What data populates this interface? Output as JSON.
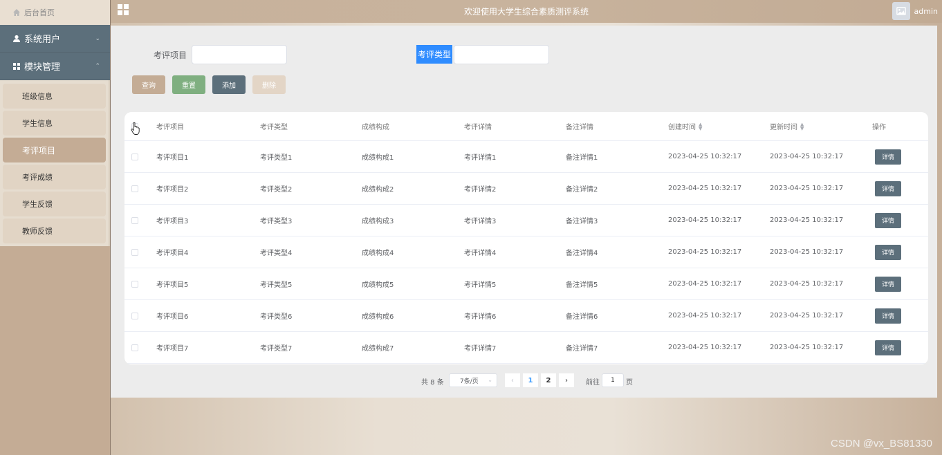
{
  "header": {
    "title": "欢迎使用大学生综合素质测评系统",
    "user": "admin"
  },
  "sidebar": {
    "home": "后台首页",
    "groups": [
      {
        "label": "系统用户",
        "arrow": "⌄"
      },
      {
        "label": "模块管理",
        "arrow": "⌃"
      }
    ],
    "items": [
      {
        "label": "班级信息"
      },
      {
        "label": "学生信息"
      },
      {
        "label": "考评项目"
      },
      {
        "label": "考评成绩"
      },
      {
        "label": "学生反馈"
      },
      {
        "label": "教师反馈"
      }
    ],
    "active_item": "考评项目"
  },
  "search": {
    "field1_label": "考评项目",
    "field1_value": "",
    "field2_label": "考评类型",
    "field2_value": ""
  },
  "buttons": {
    "query": "查询",
    "reset": "重置",
    "add": "添加",
    "delete": "删除"
  },
  "table": {
    "columns": [
      "考评项目",
      "考评类型",
      "成绩构成",
      "考评详情",
      "备注详情",
      "创建时间",
      "更新时间",
      "操作"
    ],
    "sortable_columns": [
      "创建时间",
      "更新时间"
    ],
    "action_label": "详情",
    "rows": [
      [
        "考评项目1",
        "考评类型1",
        "成绩构成1",
        "考评详情1",
        "备注详情1",
        "2023-04-25 10:32:17",
        "2023-04-25 10:32:17"
      ],
      [
        "考评项目2",
        "考评类型2",
        "成绩构成2",
        "考评详情2",
        "备注详情2",
        "2023-04-25 10:32:17",
        "2023-04-25 10:32:17"
      ],
      [
        "考评项目3",
        "考评类型3",
        "成绩构成3",
        "考评详情3",
        "备注详情3",
        "2023-04-25 10:32:17",
        "2023-04-25 10:32:17"
      ],
      [
        "考评项目4",
        "考评类型4",
        "成绩构成4",
        "考评详情4",
        "备注详情4",
        "2023-04-25 10:32:17",
        "2023-04-25 10:32:17"
      ],
      [
        "考评项目5",
        "考评类型5",
        "成绩构成5",
        "考评详情5",
        "备注详情5",
        "2023-04-25 10:32:17",
        "2023-04-25 10:32:17"
      ],
      [
        "考评项目6",
        "考评类型6",
        "成绩构成6",
        "考评详情6",
        "备注详情6",
        "2023-04-25 10:32:17",
        "2023-04-25 10:32:17"
      ],
      [
        "考评项目7",
        "考评类型7",
        "成绩构成7",
        "考评详情7",
        "备注详情7",
        "2023-04-25 10:32:17",
        "2023-04-25 10:32:17"
      ]
    ]
  },
  "pagination": {
    "total": "共 8 条",
    "page_size": "7条/页",
    "prev": "‹",
    "pages": [
      "1",
      "2"
    ],
    "current_page": "1",
    "next": "›",
    "goto_label": "前往",
    "goto_value": "1",
    "goto_unit": "页"
  },
  "watermark": "CSDN @vx_BS81330",
  "colors": {
    "accent_beige": "#c4ac95",
    "reset_green": "#7faf80",
    "slate": "#5c6f7b",
    "highlight_blue": "#2f8cff",
    "page_active": "#409eff"
  }
}
